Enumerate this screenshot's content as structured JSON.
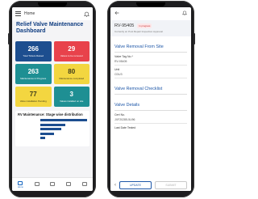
{
  "colors": {
    "navy": "#1d4e8f",
    "red": "#e8424b",
    "teal": "#1e8f93",
    "yellow": "#f3d640",
    "accent_blue": "#1e57a8"
  },
  "left_screen": {
    "topbar_title": "Home",
    "dashboard_title": "Relief Valve Maintenance Dashboard",
    "tiles": [
      {
        "value": "266",
        "label": "Total Tickets Raised",
        "color": "navy"
      },
      {
        "value": "29",
        "label": "Valves to be removed",
        "color": "red"
      },
      {
        "value": "263",
        "label": "Maintenance in Progress",
        "color": "teal"
      },
      {
        "value": "80",
        "label": "Maintenance completed",
        "color": "yellow"
      },
      {
        "value": "77",
        "label": "Valve installation Pending",
        "color": "yellow"
      },
      {
        "value": "3",
        "label": "Valves installed on site",
        "color": "teal"
      }
    ],
    "chart_title": "RV Maintenance: Stage wise distribution",
    "nav": [
      "Home",
      "",
      "",
      "",
      ""
    ]
  },
  "chart_data": {
    "type": "bar",
    "title": "RV Maintenance: Stage wise distribution",
    "categories": [
      "",
      "",
      "",
      "",
      ""
    ],
    "values": [
      266,
      140,
      120,
      80,
      29
    ]
  },
  "right_screen": {
    "record_id": "RV-95405",
    "status_badge": "In progress",
    "subtitle": "Currently at: Post Repair Inspection Approval",
    "section_removal": "Valve Removal From Site",
    "field_tag_label": "Valve Tag No.*",
    "field_tag_value": "RV-95405",
    "field_unit_label": "Unit",
    "field_unit_value": "CDU3",
    "section_checklist": "Valve Removal Checklist",
    "section_details": "Valve Details",
    "field_cert_label": "Cert No.",
    "field_cert_value": "JXF20285-5U96",
    "field_last_tested_label": "Last Date Tested",
    "update_label": "UPDATE",
    "submit_label": "SUBMIT"
  }
}
